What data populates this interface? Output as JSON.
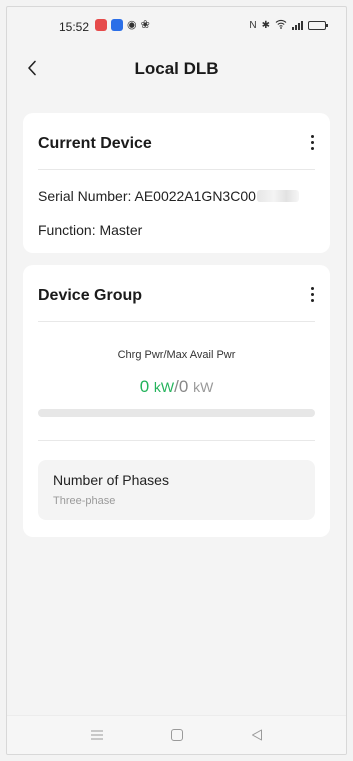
{
  "status_bar": {
    "time": "15:52",
    "right_icons": [
      "nfc-icon",
      "bluetooth-icon",
      "wifi-icon",
      "signal-icon",
      "battery-icon"
    ]
  },
  "header": {
    "title": "Local DLB",
    "back_icon": "chevron-left-icon"
  },
  "current_device": {
    "title": "Current Device",
    "serial_label": "Serial Number: AE0022A1GN3C00",
    "function_label": "Function: Master"
  },
  "device_group": {
    "title": "Device Group",
    "power_label": "Chrg Pwr/Max Avail Pwr",
    "charge_power": "0",
    "charge_unit": "kW",
    "separator": "/",
    "max_power": "0",
    "max_unit": "kW",
    "progress_fraction": 0,
    "phases_title": "Number of Phases",
    "phases_value": "Three-phase"
  },
  "colors": {
    "accent_green": "#23b35b",
    "background": "#f4f4f4",
    "card": "#ffffff"
  },
  "nav_bar": {
    "icons": [
      "menu-icon",
      "home-icon",
      "back-triangle-icon"
    ]
  }
}
